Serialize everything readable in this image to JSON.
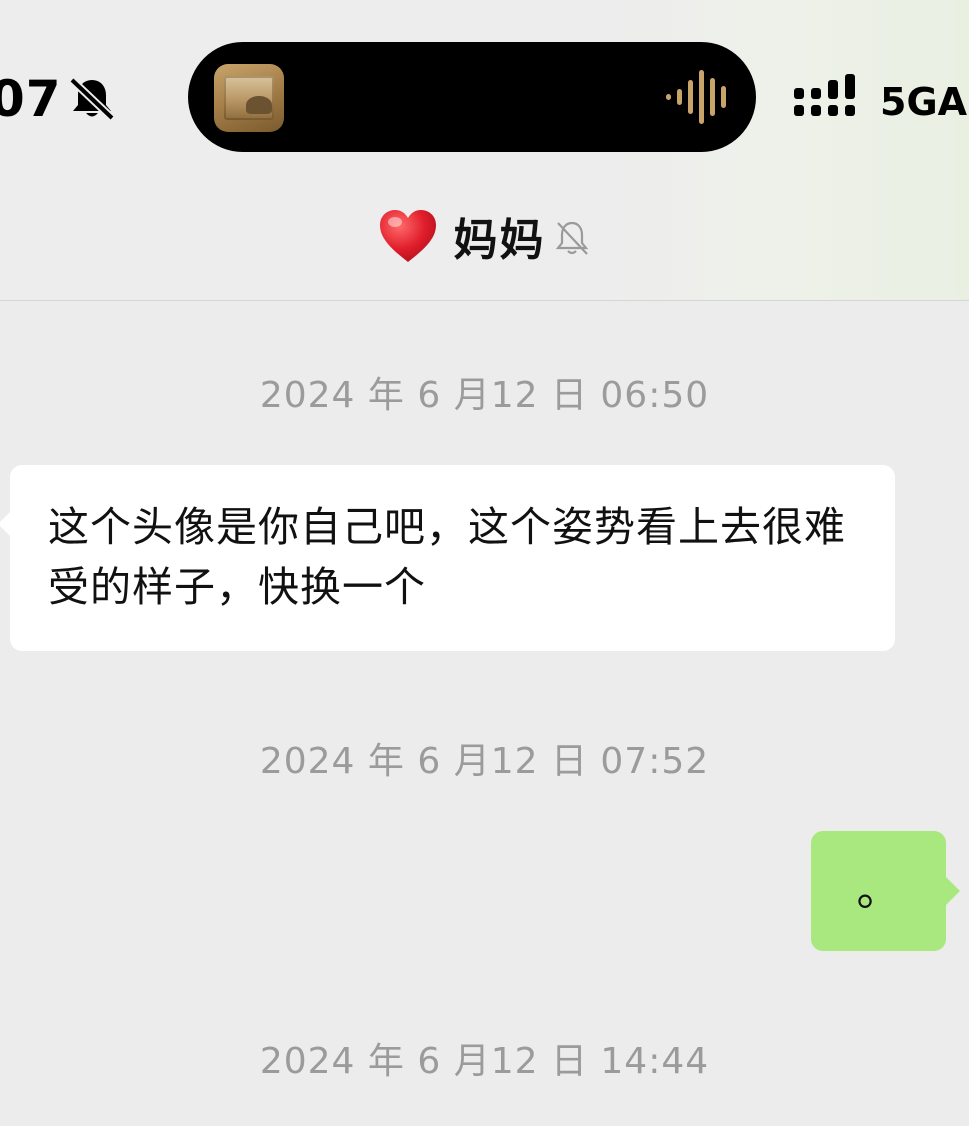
{
  "status_bar": {
    "time": "07",
    "network_label": "5GA",
    "icons": [
      "bell-slash-icon",
      "signal-bars-icon",
      "audio-waveform-icon"
    ]
  },
  "header": {
    "title": "妈妈",
    "title_emoji": "heart-icon",
    "muted_icon": "bell-slash-icon"
  },
  "messages": [
    {
      "type": "timestamp",
      "text": "2024 年 6 月12 日 06:50"
    },
    {
      "type": "incoming",
      "text": "这个头像是你自己吧，这个姿势看上去很难受的样子，快换一个"
    },
    {
      "type": "timestamp",
      "text": "2024 年 6 月12 日 07:52"
    },
    {
      "type": "outgoing",
      "text": "。"
    },
    {
      "type": "timestamp",
      "text": "2024 年 6 月12 日 14:44"
    }
  ],
  "colors": {
    "background": "#ececec",
    "incoming_bubble": "#ffffff",
    "outgoing_bubble": "#a9e87e",
    "timestamp_text": "#9b9b9b",
    "island": "#000000",
    "waveform": "#c9a46a"
  }
}
